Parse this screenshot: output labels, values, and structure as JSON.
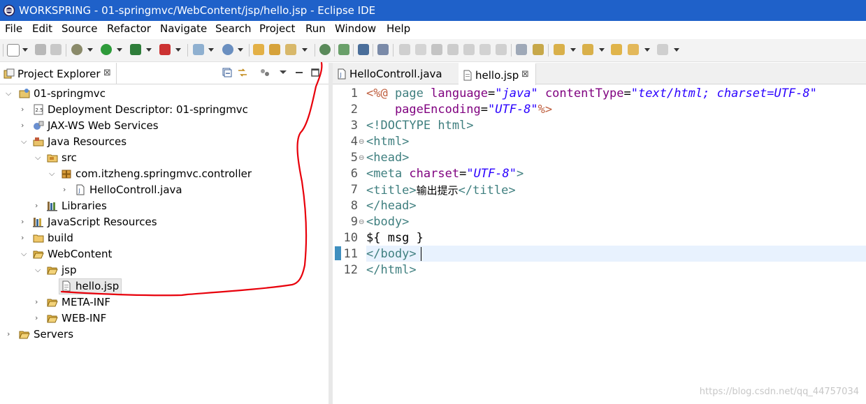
{
  "window": {
    "title": "WORKSPRING - 01-springmvc/WebContent/jsp/hello.jsp - Eclipse IDE"
  },
  "menu": [
    "File",
    "Edit",
    "Source",
    "Refactor",
    "Navigate",
    "Search",
    "Project",
    "Run",
    "Window",
    "Help"
  ],
  "project_explorer": {
    "tab_label": "Project Explorer",
    "close_glyph": "⊠",
    "tree": [
      {
        "label": "01-springmvc",
        "icon": "project-icon",
        "expanded": true
      },
      {
        "label": "Deployment Descriptor: 01-springmvc",
        "icon": "deployment-descriptor-icon",
        "expanded": false
      },
      {
        "label": "JAX-WS Web Services",
        "icon": "web-services-icon",
        "expanded": false
      },
      {
        "label": "Java Resources",
        "icon": "java-resources-icon",
        "expanded": true
      },
      {
        "label": "src",
        "icon": "source-folder-icon",
        "expanded": true
      },
      {
        "label": "com.itzheng.springmvc.controller",
        "icon": "package-icon",
        "expanded": true
      },
      {
        "label": "HelloControll.java",
        "icon": "java-file-icon",
        "expanded": false
      },
      {
        "label": "Libraries",
        "icon": "libraries-icon",
        "expanded": false
      },
      {
        "label": "JavaScript Resources",
        "icon": "javascript-resources-icon",
        "expanded": false
      },
      {
        "label": "build",
        "icon": "folder-icon",
        "expanded": false
      },
      {
        "label": "WebContent",
        "icon": "folder-icon",
        "expanded": true
      },
      {
        "label": "jsp",
        "icon": "folder-icon",
        "expanded": true
      },
      {
        "label": "hello.jsp",
        "icon": "jsp-file-icon",
        "selected": true
      },
      {
        "label": "META-INF",
        "icon": "folder-icon",
        "expanded": false
      },
      {
        "label": "WEB-INF",
        "icon": "folder-icon",
        "expanded": false
      },
      {
        "label": "Servers",
        "icon": "folder-icon",
        "expanded": false
      }
    ]
  },
  "editor": {
    "tabs": [
      {
        "label": "HelloControll.java",
        "active": false
      },
      {
        "label": "hello.jsp",
        "active": true,
        "close_glyph": "⊠"
      }
    ],
    "line_numbers": [
      "1",
      "2",
      "3",
      "4",
      "5",
      "6",
      "7",
      "8",
      "9",
      "10",
      "11",
      "12"
    ],
    "lines": {
      "l1": {
        "a": "<%@",
        "b": " page ",
        "c": "language",
        "d": "=",
        "e": "\"java\"",
        "f": " contentType",
        "g": "=",
        "h": "\"text/html; charset=UTF-8\""
      },
      "l2": {
        "a": "    pageEncoding",
        "b": "=",
        "c": "\"UTF-8\"",
        "d": "%>"
      },
      "l3": {
        "a": "<!DOCTYPE html>"
      },
      "l4": {
        "a": "<html>"
      },
      "l5": {
        "a": "<head>"
      },
      "l6": {
        "a": "<meta",
        "b": " charset",
        "c": "=",
        "d": "\"UTF-8\"",
        "e": ">"
      },
      "l7": {
        "a": "<title>",
        "b": "输出提示",
        "c": "</title>"
      },
      "l8": {
        "a": "</head>"
      },
      "l9": {
        "a": "<body>"
      },
      "l10": {
        "a": "${ msg }"
      },
      "l11": {
        "a": "</body>"
      },
      "l12": {
        "a": "</html>"
      }
    },
    "fold_glyph": "⊖"
  },
  "watermark": "https://blog.csdn.net/qq_44757034",
  "colors": {
    "titlebar": "#1f61c9",
    "annotation": "#e8000b",
    "tag": "#3f7f7f",
    "attribute": "#7f007f",
    "string": "#2a00ff"
  }
}
